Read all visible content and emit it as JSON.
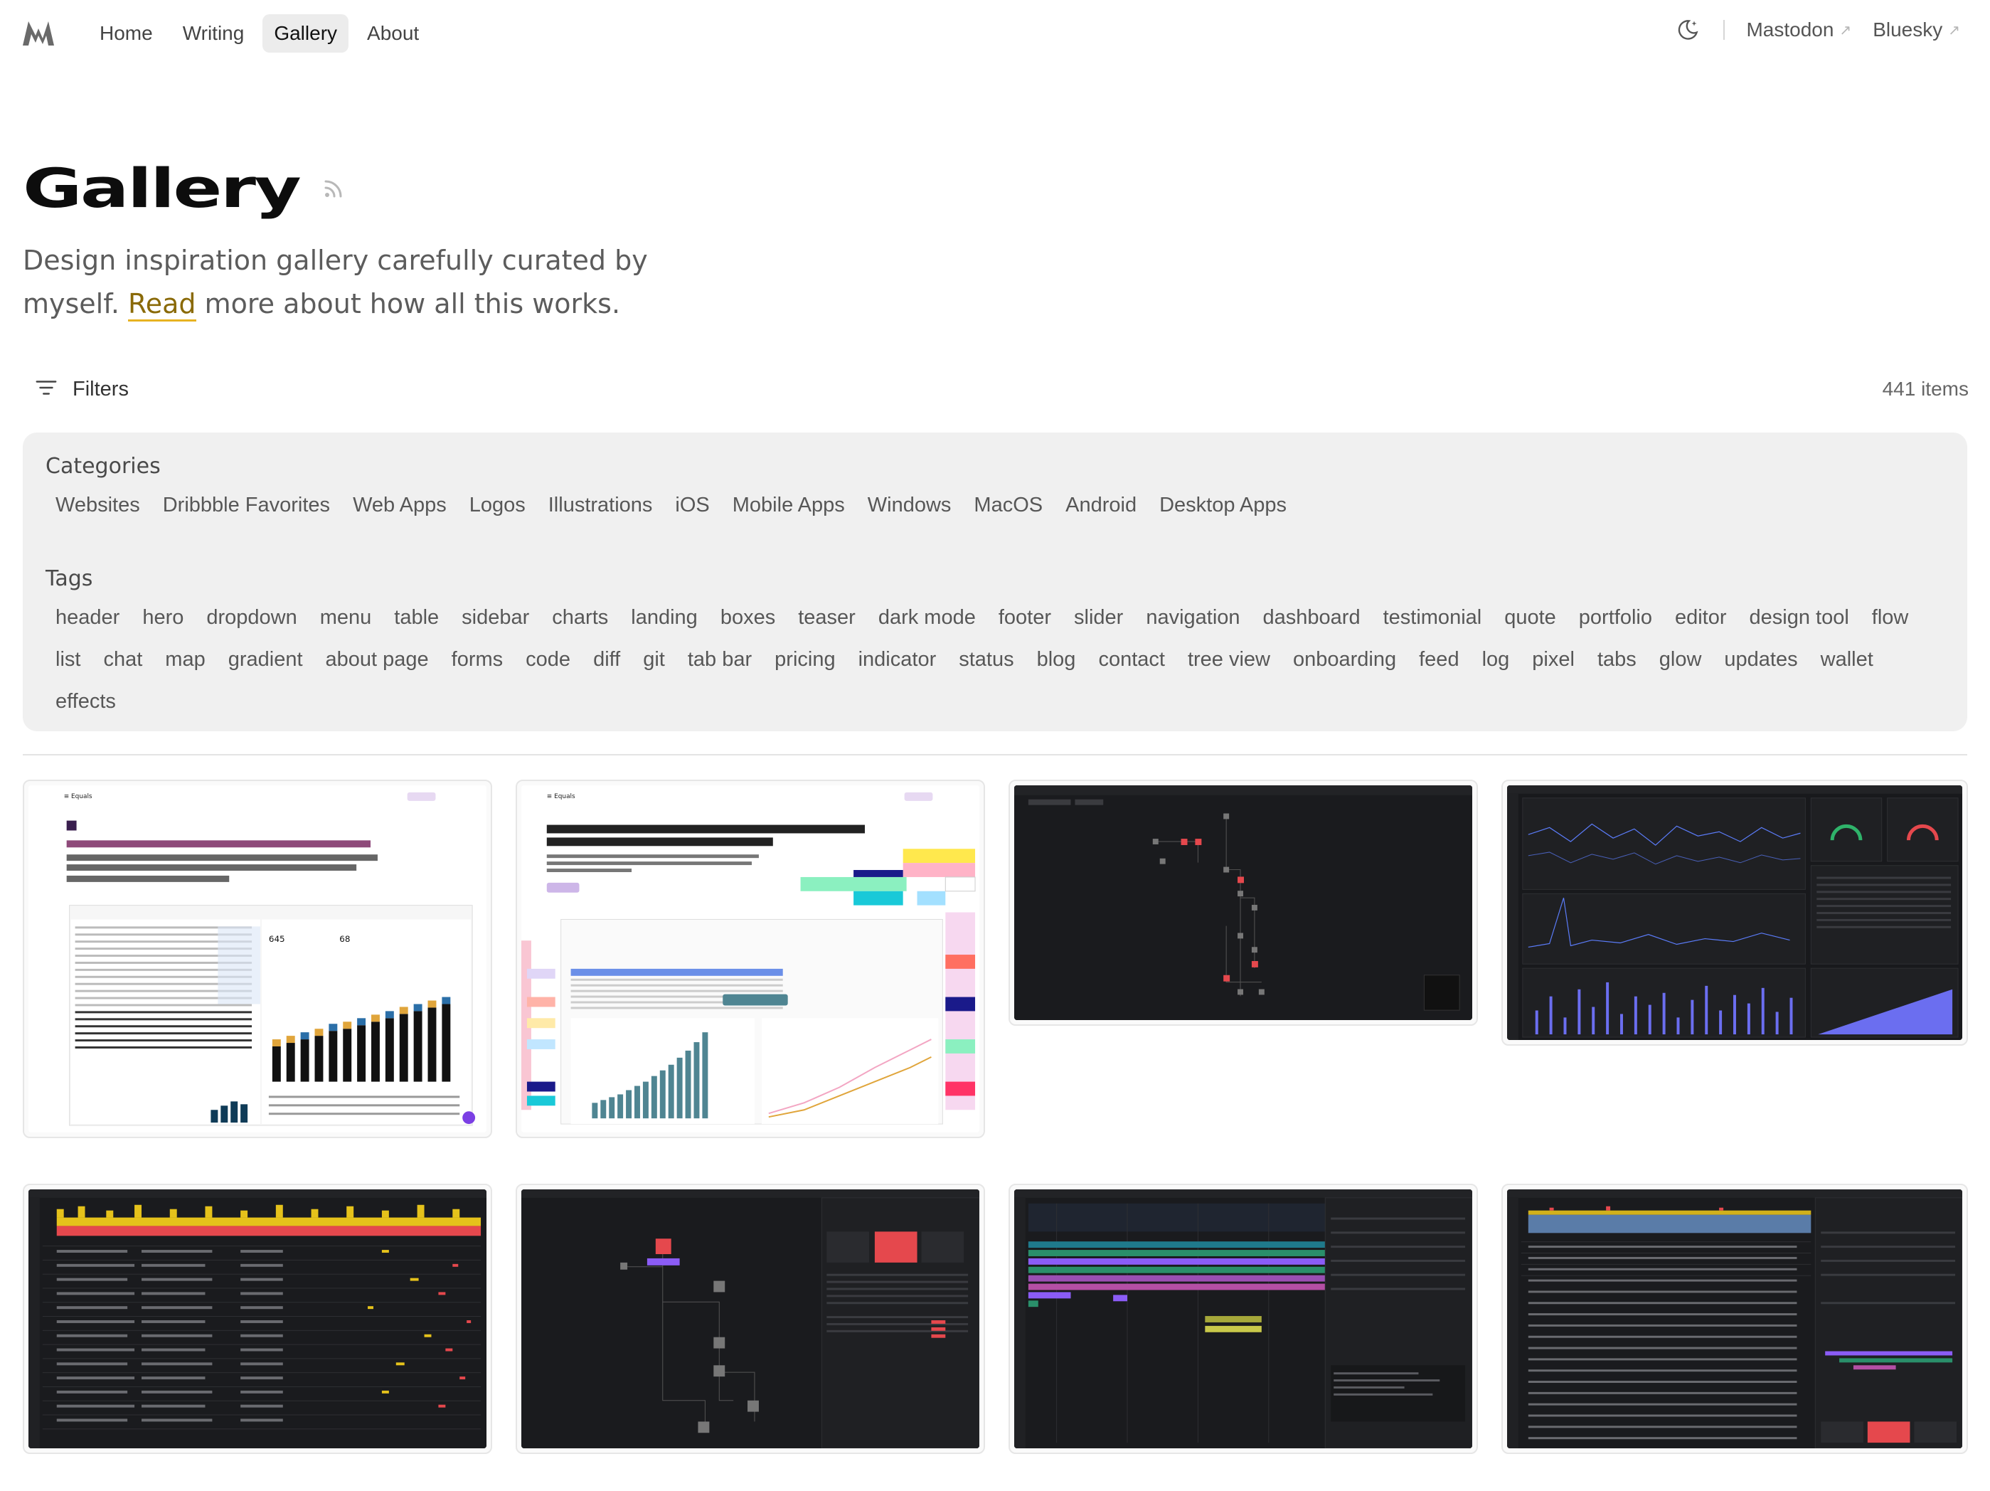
{
  "nav": {
    "links": [
      {
        "label": "Home",
        "active": false
      },
      {
        "label": "Writing",
        "active": false
      },
      {
        "label": "Gallery",
        "active": true
      },
      {
        "label": "About",
        "active": false
      }
    ],
    "external": [
      {
        "label": "Mastodon",
        "arrow": "↗"
      },
      {
        "label": "Bluesky",
        "arrow": "↗"
      }
    ],
    "theme_icon": "moon-star-icon",
    "logo_icon": "logo-icon"
  },
  "header": {
    "title": "Gallery",
    "rss_icon": "rss-icon",
    "description_part1": "Design inspiration gallery carefully curated by myself. ",
    "link_text": "Read",
    "description_part2": " more about how all this works."
  },
  "filters": {
    "label": "Filters",
    "icon": "filter-lines-icon",
    "count": "441 items"
  },
  "categories": {
    "heading": "Categories",
    "items": [
      "Websites",
      "Dribbble Favorites",
      "Web Apps",
      "Logos",
      "Illustrations",
      "iOS",
      "Mobile Apps",
      "Windows",
      "MacOS",
      "Android",
      "Desktop Apps"
    ]
  },
  "tags": {
    "heading": "Tags",
    "items": [
      "header",
      "hero",
      "dropdown",
      "menu",
      "table",
      "sidebar",
      "charts",
      "landing",
      "boxes",
      "teaser",
      "dark mode",
      "footer",
      "slider",
      "navigation",
      "dashboard",
      "testimonial",
      "quote",
      "portfolio",
      "editor",
      "design tool",
      "flow",
      "list",
      "chat",
      "map",
      "gradient",
      "about page",
      "forms",
      "code",
      "diff",
      "git",
      "tab bar",
      "pricing",
      "indicator",
      "status",
      "blog",
      "contact",
      "tree view",
      "onboarding",
      "feed",
      "log",
      "pixel",
      "tabs",
      "glow",
      "updates",
      "wallet",
      "effects"
    ]
  },
  "gallery": {
    "cards": [
      {
        "theme": "light",
        "kind": "equals-dashboard"
      },
      {
        "theme": "light",
        "kind": "equals-spreadsheet"
      },
      {
        "theme": "dark",
        "kind": "service-map"
      },
      {
        "theme": "dark",
        "kind": "metrics-dashboard"
      },
      {
        "theme": "dark",
        "kind": "issues-list"
      },
      {
        "theme": "dark",
        "kind": "service-map-panel"
      },
      {
        "theme": "dark",
        "kind": "trace-waterfall"
      },
      {
        "theme": "dark",
        "kind": "log-viewer"
      }
    ],
    "colors": {
      "accent_red": "#e5484d",
      "accent_yellow": "#e5c21b",
      "accent_purple": "#8b5cf6",
      "accent_blue": "#5b7cfa",
      "accent_teal": "#4f8592",
      "brand_purple": "#6b2a6b"
    }
  }
}
